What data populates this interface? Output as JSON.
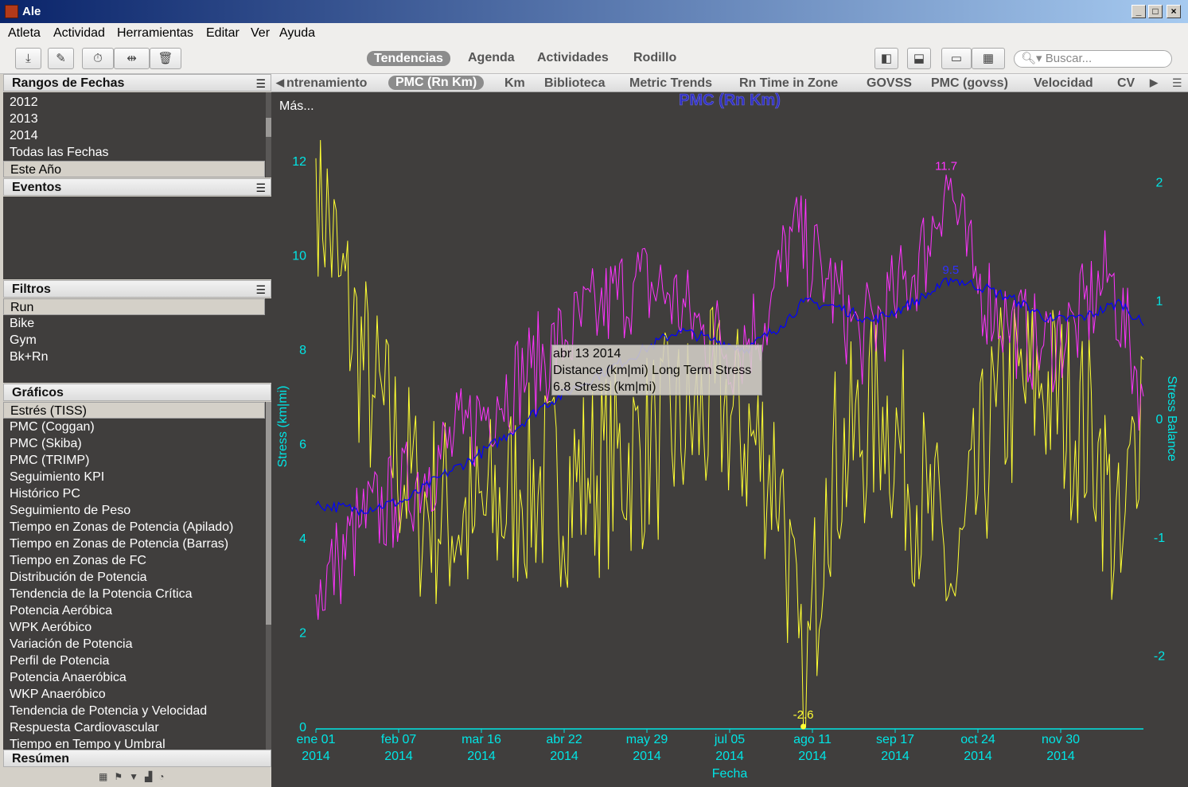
{
  "window": {
    "title": "Ale",
    "minimize": "_",
    "maximize": "□",
    "close": "×"
  },
  "menu": [
    "Atleta",
    "Actividad",
    "Herramientas",
    "Editar",
    "Ver",
    "Ayuda"
  ],
  "toolbar": {
    "views": [
      "Tendencias",
      "Agenda",
      "Actividades",
      "Rodillo"
    ],
    "selected_view": "Tendencias",
    "search_placeholder": "Buscar..."
  },
  "sidebar": {
    "rangos": {
      "title": "Rangos de Fechas",
      "items": [
        "2012",
        "2013",
        "2014",
        "Todas las Fechas",
        "Este Año"
      ],
      "selected": "Este Año"
    },
    "eventos": {
      "title": "Eventos"
    },
    "filtros": {
      "title": "Filtros",
      "items": [
        "Run",
        "Bike",
        "Gym",
        "Bk+Rn"
      ],
      "selected": "Run"
    },
    "graficos": {
      "title": "Gráficos",
      "items": [
        "Estrés (TISS)",
        "PMC (Coggan)",
        "PMC (Skiba)",
        "PMC (TRIMP)",
        "Seguimiento KPI",
        "Histórico PC",
        "Seguimiento de Peso",
        "Tiempo en Zonas de Potencia (Apilado)",
        "Tiempo en Zonas de Potencia (Barras)",
        "Tiempo en Zonas de FC",
        "Distribución de Potencia",
        "Tendencia de la Potencia Crítica",
        "Potencia Aeróbica",
        "WPK Aeróbico",
        "Variación de Potencia",
        "Perfil de Potencia",
        "Potencia Anaeróbica",
        "WKP Anaeróbico",
        "Tendencia de Potencia y Velocidad",
        "Respuesta Cardiovascular",
        "Tiempo en Tempo y Umbral"
      ],
      "selected": "Estrés (TISS)"
    },
    "resumen": {
      "title": "Resúmen"
    }
  },
  "chart_tabs": [
    "ntrenamiento",
    "PMC (Rn Km)",
    "Km",
    "Biblioteca",
    "Metric Trends",
    "Rn Time in Zone",
    "GOVSS",
    "PMC (govss)",
    "Velocidad",
    "CV"
  ],
  "chart_tabs_selected": "PMC (Rn Km)",
  "mas_label": "Más...",
  "tooltip": {
    "line1": "abr 13 2014",
    "line2": "Distance (km|mi) Long Term Stress",
    "line3": "6.8 Stress (km|mi)"
  },
  "chart_data": {
    "type": "line",
    "title": "PMC (Rn Km)",
    "xlabel": "Fecha",
    "ylabel": "Stress (km|mi)",
    "y2label": "Stress Balance",
    "ylim": [
      0,
      12.3
    ],
    "y2lim": [
      -2.6,
      2.3
    ],
    "x_ticks": [
      [
        "ene 01",
        "2014"
      ],
      [
        "feb 07",
        "2014"
      ],
      [
        "mar 16",
        "2014"
      ],
      [
        "abr 22",
        "2014"
      ],
      [
        "may 29",
        "2014"
      ],
      [
        "jul 05",
        "2014"
      ],
      [
        "ago 11",
        "2014"
      ],
      [
        "sep 17",
        "2014"
      ],
      [
        "oct 24",
        "2014"
      ],
      [
        "nov 30",
        "2014"
      ]
    ],
    "y_ticks": [
      0,
      2,
      4,
      6,
      8,
      10,
      12
    ],
    "y2_ticks": [
      -2,
      -1,
      0,
      1,
      2
    ],
    "annotations": [
      {
        "text": "11.7",
        "series": "short"
      },
      {
        "text": "9.5",
        "series": "long"
      },
      {
        "text": "-2.6",
        "series": "balance"
      }
    ],
    "days": 365,
    "series": [
      {
        "color": "#0000ff",
        "axis": "left",
        "keys": [
          [
            0,
            4.7
          ],
          [
            20,
            4.6
          ],
          [
            40,
            4.8
          ],
          [
            55,
            5.3
          ],
          [
            70,
            5.7
          ],
          [
            85,
            6.2
          ],
          [
            100,
            6.8
          ],
          [
            115,
            7.2
          ],
          [
            130,
            7.6
          ],
          [
            145,
            8.0
          ],
          [
            160,
            8.4
          ],
          [
            175,
            8.2
          ],
          [
            190,
            8.0
          ],
          [
            205,
            8.5
          ],
          [
            215,
            9.0
          ],
          [
            230,
            8.9
          ],
          [
            245,
            8.6
          ],
          [
            260,
            8.9
          ],
          [
            275,
            9.3
          ],
          [
            280,
            9.5
          ],
          [
            295,
            9.3
          ],
          [
            310,
            9.0
          ],
          [
            325,
            8.6
          ],
          [
            340,
            8.7
          ],
          [
            355,
            9.0
          ],
          [
            365,
            8.5
          ]
        ]
      },
      {
        "color": "#ff33ff",
        "axis": "left",
        "keys": [
          [
            0,
            2.8
          ],
          [
            10,
            3.5
          ],
          [
            20,
            4.3
          ],
          [
            35,
            4.8
          ],
          [
            50,
            5.5
          ],
          [
            65,
            6.2
          ],
          [
            80,
            7.0
          ],
          [
            95,
            7.6
          ],
          [
            110,
            8.2
          ],
          [
            125,
            8.8
          ],
          [
            140,
            9.4
          ],
          [
            155,
            9.2
          ],
          [
            170,
            8.4
          ],
          [
            185,
            8.0
          ],
          [
            200,
            8.8
          ],
          [
            210,
            10.5
          ],
          [
            225,
            9.5
          ],
          [
            240,
            8.2
          ],
          [
            255,
            9.0
          ],
          [
            270,
            10.2
          ],
          [
            278,
            11.7
          ],
          [
            290,
            9.5
          ],
          [
            305,
            8.6
          ],
          [
            320,
            8.0
          ],
          [
            335,
            8.5
          ],
          [
            350,
            9.6
          ],
          [
            365,
            7.0
          ]
        ]
      },
      {
        "color": "#ffff33",
        "axis": "right",
        "keys": [
          [
            0,
            2.2
          ],
          [
            10,
            1.2
          ],
          [
            25,
            0.2
          ],
          [
            45,
            -0.7
          ],
          [
            70,
            -0.9
          ],
          [
            90,
            -0.6
          ],
          [
            120,
            -0.5
          ],
          [
            150,
            -0.2
          ],
          [
            180,
            0.1
          ],
          [
            205,
            -0.5
          ],
          [
            215,
            -2.6
          ],
          [
            225,
            -0.5
          ],
          [
            250,
            0.1
          ],
          [
            270,
            -0.8
          ],
          [
            282,
            -1.5
          ],
          [
            300,
            0.1
          ],
          [
            320,
            0.3
          ],
          [
            345,
            -0.2
          ],
          [
            355,
            -1.3
          ],
          [
            365,
            0.5
          ]
        ]
      }
    ]
  }
}
